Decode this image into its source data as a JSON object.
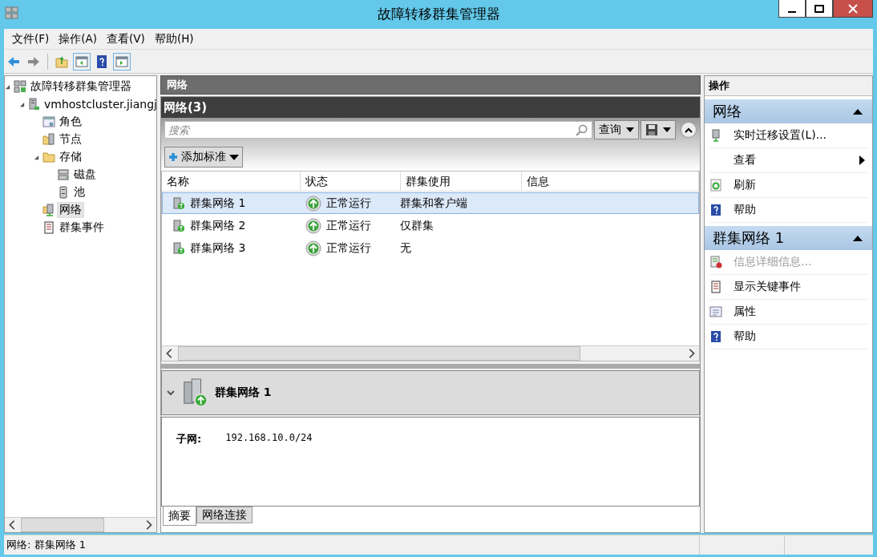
{
  "window": {
    "title": "故障转移群集管理器"
  },
  "menu": [
    "文件(F)",
    "操作(A)",
    "查看(V)",
    "帮助(H)"
  ],
  "tree": [
    {
      "label": "故障转移群集管理器",
      "kind": "manager",
      "selected": false,
      "expanded": true,
      "children": [
        {
          "label": "vmhostcluster.jiangj",
          "kind": "cluster",
          "selected": false,
          "expanded": true,
          "children": [
            {
              "label": "角色",
              "kind": "roles",
              "selected": false
            },
            {
              "label": "节点",
              "kind": "nodes",
              "selected": false
            },
            {
              "label": "存储",
              "kind": "storage",
              "selected": false,
              "expanded": true,
              "children": [
                {
                  "label": "磁盘",
                  "kind": "disks",
                  "selected": false
                },
                {
                  "label": "池",
                  "kind": "pools",
                  "selected": false
                }
              ]
            },
            {
              "label": "网络",
              "kind": "networks",
              "selected": true
            },
            {
              "label": "群集事件",
              "kind": "events",
              "selected": false
            }
          ]
        }
      ]
    }
  ],
  "center": {
    "header": "网络",
    "list_title": "网络(3)",
    "search": {
      "placeholder": "搜索"
    },
    "query_button": "查询",
    "add_criteria": "添加标准",
    "columns": [
      "名称",
      "状态",
      "群集使用",
      "信息"
    ],
    "rows": [
      {
        "name": "群集网络 1",
        "status": "正常运行",
        "usage": "群集和客户端",
        "selected": true
      },
      {
        "name": "群集网络 2",
        "status": "正常运行",
        "usage": "仅群集",
        "selected": false
      },
      {
        "name": "群集网络 3",
        "status": "正常运行",
        "usage": "无",
        "selected": false
      }
    ],
    "detail": {
      "title": "群集网络 1",
      "fields": [
        {
          "label": "子网:",
          "value": "192.168.10.0/24"
        }
      ],
      "tabs": [
        {
          "label": "摘要",
          "selected": true
        },
        {
          "label": "网络连接",
          "selected": false
        }
      ]
    }
  },
  "actions": {
    "title": "操作",
    "sections": [
      {
        "title": "网络",
        "items": [
          {
            "label": "实时迁移设置(L)...",
            "kind": "migration",
            "disabled": false,
            "submenu": false
          },
          {
            "label": "查看",
            "kind": "none",
            "disabled": false,
            "submenu": true
          },
          {
            "label": "刷新",
            "kind": "refresh",
            "disabled": false,
            "submenu": false
          },
          {
            "label": "帮助",
            "kind": "help",
            "disabled": false,
            "submenu": false
          }
        ]
      },
      {
        "title": "群集网络 1",
        "items": [
          {
            "label": "信息详细信息...",
            "kind": "info",
            "disabled": true,
            "submenu": false
          },
          {
            "label": "显示关键事件",
            "kind": "events",
            "disabled": false,
            "submenu": false
          },
          {
            "label": "属性",
            "kind": "properties",
            "disabled": false,
            "submenu": false
          },
          {
            "label": "帮助",
            "kind": "help",
            "disabled": false,
            "submenu": false
          }
        ]
      }
    ]
  },
  "status_bar": {
    "text": "网络: 群集网络 1"
  }
}
